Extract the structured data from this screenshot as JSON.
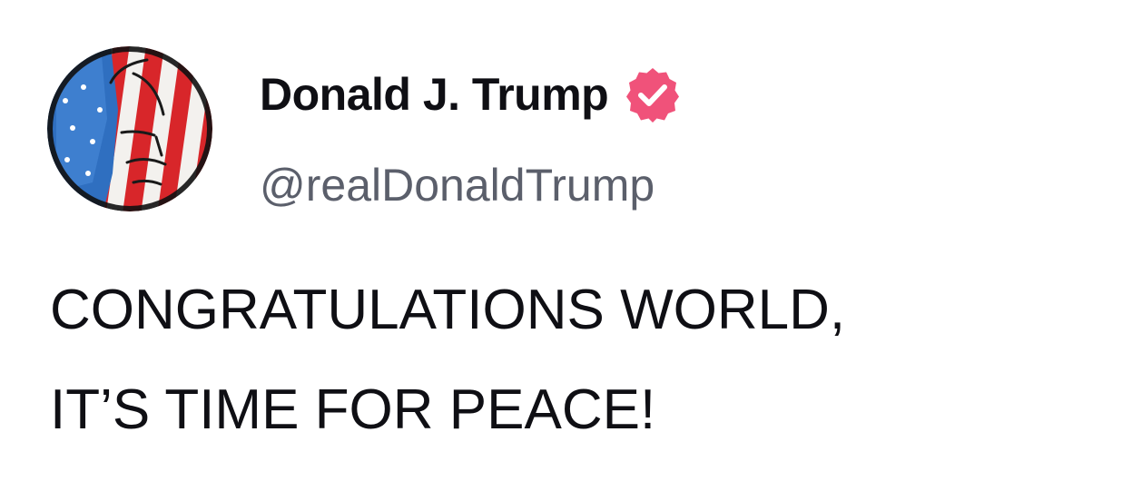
{
  "post": {
    "author": {
      "display_name": "Donald J. Trump",
      "handle": "@realDonaldTrump",
      "verified": true,
      "verified_badge_icon": "verified-check-badge-icon",
      "avatar_icon": "avatar-flag-painted-face"
    },
    "text_lines": [
      "CONGRATULATIONS WORLD,",
      "IT’S TIME FOR PEACE!"
    ]
  },
  "colors": {
    "text": "#0f0f14",
    "handle": "#5b5f6b",
    "badge": "#f0527a",
    "background": "#ffffff"
  }
}
